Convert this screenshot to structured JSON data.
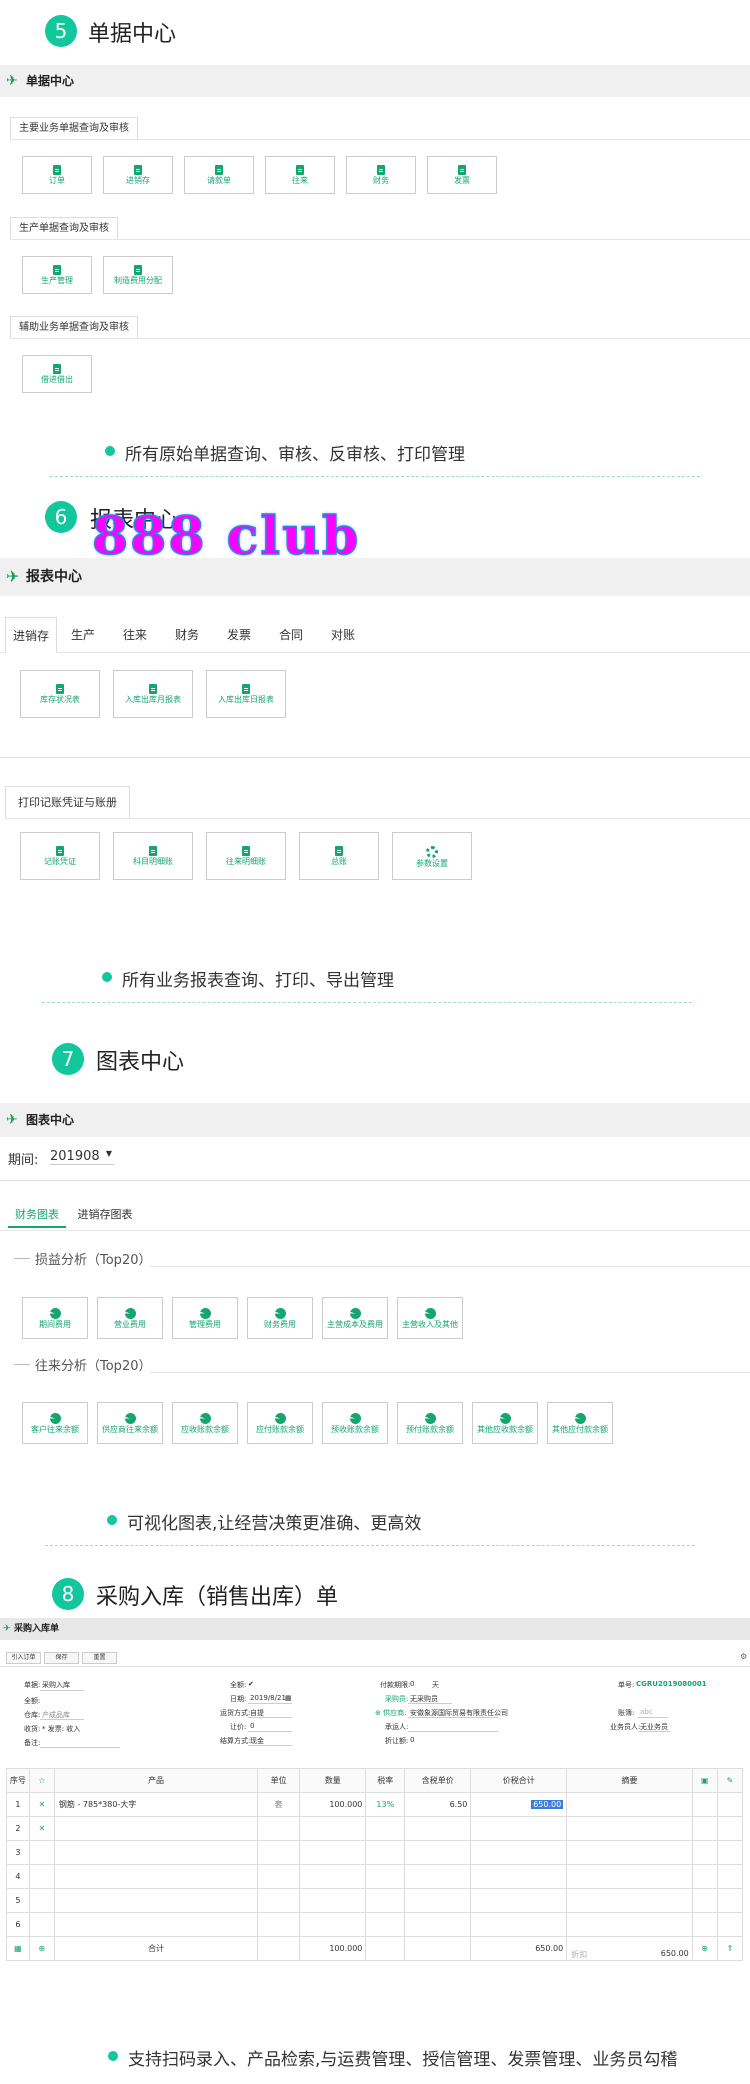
{
  "s5": {
    "num": "5",
    "title": "单据中心",
    "bar": "单据中心",
    "g1": "主要业务单据查询及审核",
    "g1_items": [
      "订单",
      "进销存",
      "请款单",
      "往来",
      "财务",
      "发票"
    ],
    "g2": "生产单据查询及审核",
    "g2_items": [
      "生产管理",
      "制造费用分配"
    ],
    "g3": "辅助业务单据查询及审核",
    "g3_items": [
      "借进借出"
    ],
    "bullet": "所有原始单据查询、审核、反审核、打印管理"
  },
  "s6": {
    "num": "6",
    "title": "报表中心",
    "bar": "报表中心",
    "watermark": "888 club",
    "tabs": [
      "进销存",
      "生产",
      "往来",
      "财务",
      "发票",
      "合同",
      "对账"
    ],
    "tab_items": [
      "库存状况表",
      "入库出库月报表",
      "入库出库日报表"
    ],
    "g2": "打印记账凭证与账册",
    "g2_items": [
      "记账凭证",
      "科目明细账",
      "往来明细账",
      "总账",
      "参数设置"
    ],
    "bullet": "所有业务报表查询、打印、导出管理"
  },
  "s7": {
    "num": "7",
    "title": "图表中心",
    "bar": "图表中心",
    "period_label": "期间:",
    "period_value": "201908",
    "tabs": [
      "财务图表",
      "进销存图表"
    ],
    "a1": "损益分析（Top20）",
    "a1_items": [
      "期间费用",
      "营业费用",
      "管理费用",
      "财务费用",
      "主营成本及费用",
      "主营收入及其他"
    ],
    "a2": "往来分析（Top20）",
    "a2_items": [
      "客户往来余额",
      "供应商往来余额",
      "应收账款余额",
      "应付账款余额",
      "预收账款余额",
      "预付账款余额",
      "其他应收款余额",
      "其他应付款余额"
    ],
    "bullet": "可视化图表,让经营决策更准确、更高效"
  },
  "s8": {
    "num": "8",
    "title": "采购入库（销售出库）单",
    "bar": "采购入库单",
    "toolbar": [
      "引入订单",
      "保存",
      "重置"
    ],
    "fields": {
      "type_label": "单据:",
      "type_value": "采购入库",
      "pay_label": "全额:",
      "date_label": "日期:",
      "date_value": "2019/8/21",
      "ship_label": "运货方式:",
      "ship_value": "自提",
      "discount_label": "让价:",
      "discount_value": "0",
      "settle_label": "结算方式:",
      "settle_value": "现金",
      "term_label": "付款期限:",
      "term_value": "0",
      "term_unit": "天",
      "buyer_label": "采购员:",
      "buyer_value": "无采购员",
      "supplier_label": "供应商:",
      "supplier_value": "安徽象源国际贸易有限责任公司",
      "recv_label": "承运人:",
      "fold_label": "折让额:",
      "fold_value": "0",
      "docno_label": "单号:",
      "docno_value": "CGRU2019080001",
      "acct_label": "账簿:",
      "acct_value": "abc",
      "sales_label": "业务员人:",
      "sales_value": "无业务员",
      "wh_label": "仓库:",
      "wh_value": "产成品库",
      "rcv_label": "收货:",
      "rcv_value": "* 发票: 收入",
      "remark_label": "备注:"
    },
    "columns": [
      "序号",
      "",
      "产品",
      "单位",
      "数量",
      "税率",
      "含税单价",
      "价税合计",
      "摘要",
      "",
      ""
    ],
    "row1": {
      "no": "1",
      "product": "钢筋 - 785*380-大字",
      "unit": "套",
      "qty": "100.000",
      "tax": "13%",
      "price": "6.50",
      "total": "650.00"
    },
    "rows": [
      "2",
      "3",
      "4",
      "5",
      "6"
    ],
    "sum": {
      "label": "合计",
      "qty": "100.000",
      "total": "650.00",
      "disc": "折扣",
      "total2": "650.00"
    },
    "bullet": "支持扫码录入、产品检索,与运费管理、授信管理、发票管理、业务员勾稽"
  }
}
